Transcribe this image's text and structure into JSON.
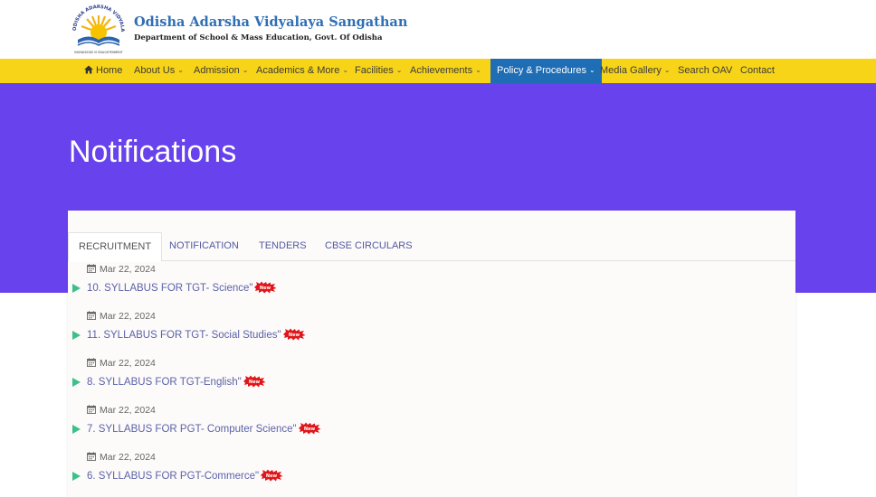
{
  "header": {
    "title": "Odisha Adarsha Vidyalaya Sangathan",
    "subtitle": "Department of School & Mass Education, Govt. Of Odisha",
    "logo_text": "ODISHA ADARSHA VIDYALAYA",
    "logo_tagline": "KNOWLEDGE IS ENLIGHTENMENT"
  },
  "nav": {
    "home": "Home",
    "about": "About Us",
    "admission": "Admission",
    "academics": "Academics & More",
    "facilities": "Facilities",
    "achievements": "Achievements",
    "policy": "Policy & Procedures",
    "media": "Media Gallery",
    "search": "Search OAV",
    "contact": "Contact"
  },
  "hero": {
    "title": "Notifications"
  },
  "tabs": {
    "recruitment": "RECRUITMENT",
    "notification": "NOTIFICATION",
    "tenders": "TENDERS",
    "cbse": "CBSE CIRCULARS"
  },
  "items": [
    {
      "date": "Mar 22, 2024",
      "title": "10. SYLLABUS FOR TGT- Science\""
    },
    {
      "date": "Mar 22, 2024",
      "title": "11. SYLLABUS FOR TGT- Social Studies\""
    },
    {
      "date": "Mar 22, 2024",
      "title": "8. SYLLABUS FOR TGT-English\""
    },
    {
      "date": "Mar 22, 2024",
      "title": "7. SYLLABUS FOR PGT- Computer Science\""
    },
    {
      "date": "Mar 22, 2024",
      "title": "6. SYLLABUS FOR PGT-Commerce\""
    }
  ],
  "badge_label": "New",
  "colors": {
    "nav_bg": "#f7d417",
    "nav_active": "#1f6db5",
    "hero_bg": "#6842ec",
    "link": "#5a63a8",
    "bullet": "#3cc08a",
    "badge": "#e0161a"
  }
}
